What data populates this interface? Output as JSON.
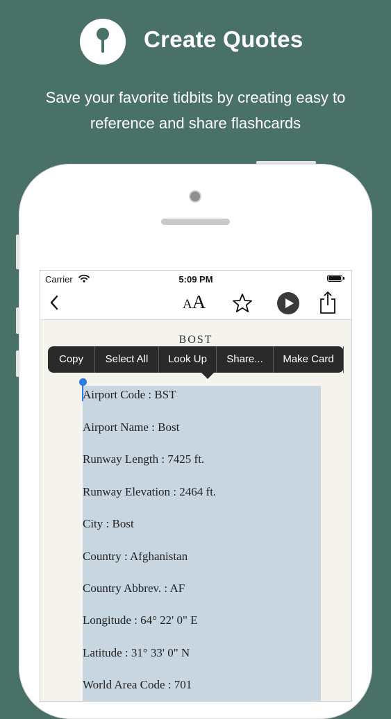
{
  "hero": {
    "title": "Create Quotes",
    "subtitle_line1": "Save your favorite tidbits by creating easy to",
    "subtitle_line2": "reference and share flashcards"
  },
  "status_bar": {
    "carrier": "Carrier",
    "time": "5:09 PM"
  },
  "toolbar": {
    "icons": [
      "back-icon",
      "font-size-icon",
      "star-icon",
      "play-icon",
      "share-icon"
    ],
    "font_small": "A",
    "font_big": "A"
  },
  "page": {
    "chapter_title": "BOST",
    "lines": [
      "Airport Code : BST",
      "Airport Name : Bost",
      "Runway Length : 7425 ft.",
      "Runway Elevation : 2464 ft.",
      "City : Bost",
      "Country : Afghanistan",
      "Country Abbrev. : AF",
      "Longitude : 64° 22' 0\" E",
      "Latitude : 31° 33' 0\" N",
      "World Area Code : 701"
    ]
  },
  "edit_menu": {
    "items": [
      "Copy",
      "Select All",
      "Look Up",
      "Share...",
      "Make Card"
    ]
  },
  "colors": {
    "background": "#4a7168",
    "selection": "#c8d6e1",
    "handle": "#2f7be6",
    "menu": "#2a2a2a"
  }
}
